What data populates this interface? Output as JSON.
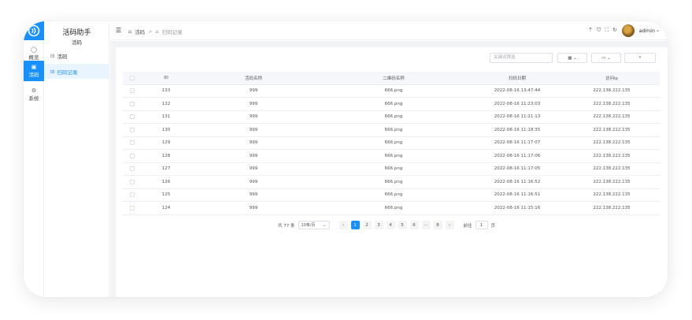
{
  "app": {
    "title": "活码助手",
    "subtitle": "活码"
  },
  "rail": [
    {
      "label": "概览",
      "icon": "home-icon",
      "glyph": "◯"
    },
    {
      "label": "活码",
      "icon": "qrcode-icon",
      "glyph": "▣"
    },
    {
      "label": "系统",
      "icon": "settings-icon",
      "glyph": "⚙"
    }
  ],
  "sidebar": {
    "items": [
      {
        "label": "活码",
        "icon": "box-icon",
        "glyph": "⊟"
      },
      {
        "label": "扫码记录",
        "icon": "box-icon",
        "glyph": "⊟"
      }
    ]
  },
  "header": {
    "menu_glyph": "☰",
    "breadcrumb": {
      "home_glyph": "⌂",
      "first": "活码",
      "sep": ">",
      "current": "扫码记录"
    },
    "icons": [
      "⇡",
      "⛉",
      "⛶",
      "↻"
    ],
    "username": "admin",
    "caret": "⌄"
  },
  "toolbar": {
    "search_placeholder": "关键词筛选",
    "btn1": "▦  ⌄",
    "btn2": "▭  ⌄",
    "btn3": "⌕"
  },
  "table": {
    "headers": [
      "ID",
      "活码名称",
      "二维码名称",
      "扫码日期",
      "访问ip"
    ],
    "rows": [
      [
        "133",
        "999",
        "666.png",
        "2022-08-16 13:47:44",
        "222.138.222.135"
      ],
      [
        "132",
        "999",
        "666.png",
        "2022-08-16 11:23:03",
        "222.138.222.135"
      ],
      [
        "131",
        "999",
        "666.png",
        "2022-08-16 11:21:13",
        "222.138.222.135"
      ],
      [
        "130",
        "999",
        "666.png",
        "2022-08-16 11:18:35",
        "222.138.222.135"
      ],
      [
        "129",
        "999",
        "666.png",
        "2022-08-16 11:17:07",
        "222.138.222.135"
      ],
      [
        "128",
        "999",
        "666.png",
        "2022-08-16 11:17:06",
        "222.138.222.135"
      ],
      [
        "127",
        "999",
        "666.png",
        "2022-08-16 11:17:05",
        "222.138.222.135"
      ],
      [
        "126",
        "999",
        "666.png",
        "2022-08-16 11:16:52",
        "222.138.222.135"
      ],
      [
        "125",
        "999",
        "666.png",
        "2022-08-16 11:16:51",
        "222.138.222.135"
      ],
      [
        "124",
        "999",
        "666.png",
        "2022-08-16 11:15:16",
        "222.138.222.135"
      ]
    ]
  },
  "pagination": {
    "total": "共 77 条",
    "page_size": "10条/页",
    "prev": "‹",
    "pages": [
      "1",
      "2",
      "3",
      "4",
      "5",
      "6",
      "···",
      "8"
    ],
    "next": "›",
    "goto_label": "前往",
    "goto_value": "1",
    "goto_suffix": "页"
  },
  "colors": {
    "accent": "#1890ff"
  }
}
